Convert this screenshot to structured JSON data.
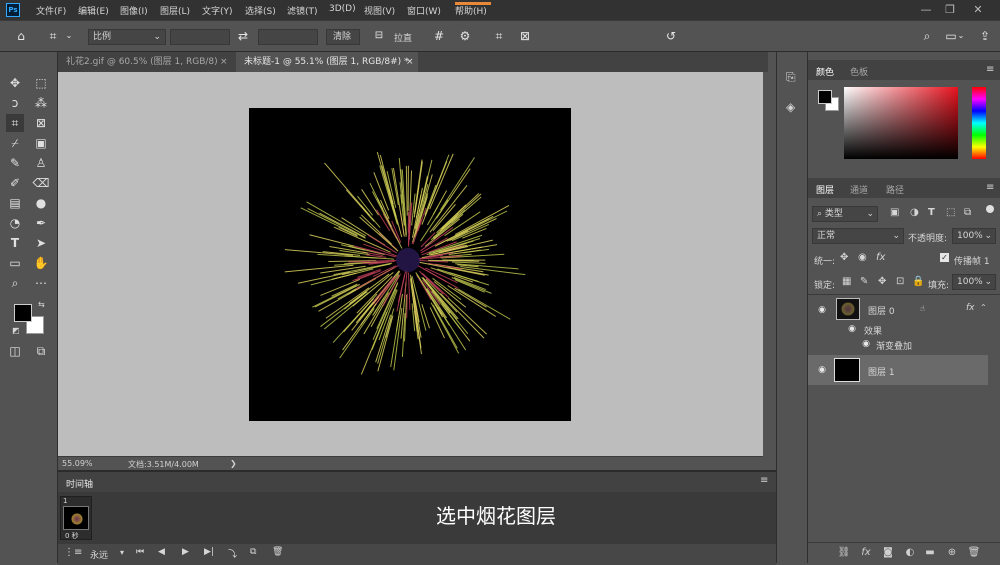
{
  "app": {
    "logo": "Ps"
  },
  "menu": [
    "文件(F)",
    "编辑(E)",
    "图像(I)",
    "图层(L)",
    "文字(Y)",
    "选择(S)",
    "滤镜(T)",
    "3D(D)",
    "视图(V)",
    "窗口(W)",
    "帮助(H)"
  ],
  "options": {
    "ratio": "比例",
    "clear": "清除",
    "straighten": "拉直"
  },
  "tabs": [
    {
      "label": "礼花2.gif @ 60.5% (图层 1, RGB/8)",
      "close": "×"
    },
    {
      "label": "未标题-1 @ 55.1% (图层 1, RGB/8#) *",
      "close": "×"
    }
  ],
  "status": {
    "zoom": "55.09%",
    "doc": "文档:3.51M/4.00M",
    "arrow": "❯"
  },
  "timeline": {
    "title": "时间轴",
    "frame_number": "1",
    "frame_delay": "0 秒",
    "loop": "永远",
    "caption": "选中烟花图层"
  },
  "color_panel": {
    "tabs": [
      "颜色",
      "色板"
    ]
  },
  "layers_panel": {
    "tabs": [
      "图层",
      "通道",
      "路径"
    ],
    "filter_kind": "类型",
    "blend_mode": "正常",
    "opacity_label": "不透明度:",
    "opacity_value": "100%",
    "unify_label": "统一:",
    "propagate_label": "传播帧 1",
    "lock_label": "锁定:",
    "fill_label": "填充:",
    "fill_value": "100%",
    "layers": [
      {
        "name": "图层 0",
        "fx": "fx"
      },
      {
        "name": "效果"
      },
      {
        "name": "渐变叠加"
      },
      {
        "name": "图层 1"
      }
    ]
  },
  "colors": {
    "accent": "#31a8ff",
    "bg": "#535353",
    "canvas": "#bdbdbd"
  }
}
